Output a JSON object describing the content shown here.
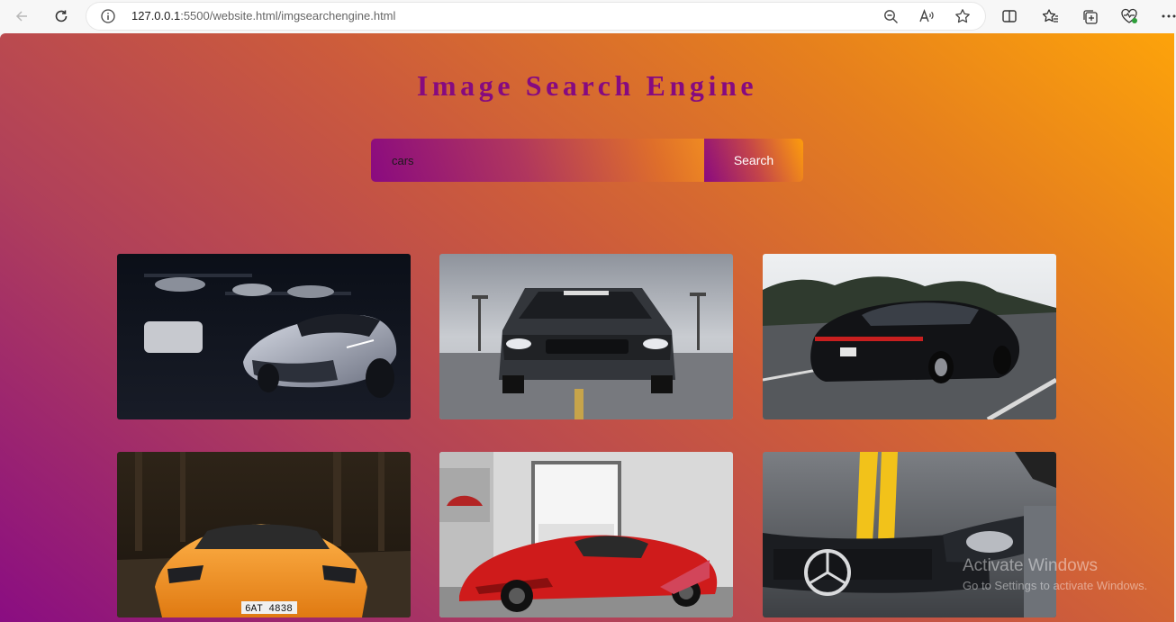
{
  "browser": {
    "url_host": "127.0.0.1",
    "url_rest": ":5500/website.html/imgsearchengine.html"
  },
  "page": {
    "title": "Image Search Engine"
  },
  "search": {
    "query": "cars",
    "button_label": "Search"
  },
  "results": [
    {
      "label": "car-photo-1"
    },
    {
      "label": "car-photo-2"
    },
    {
      "label": "car-photo-3"
    },
    {
      "label": "car-photo-4"
    },
    {
      "label": "car-photo-5"
    },
    {
      "label": "car-photo-6"
    }
  ],
  "watermark": {
    "title": "Activate Windows",
    "subtitle": "Go to Settings to activate Windows."
  },
  "colors": {
    "title": "#860a80",
    "gradient_start": "#8a0d82",
    "gradient_end": "#fda30a"
  }
}
